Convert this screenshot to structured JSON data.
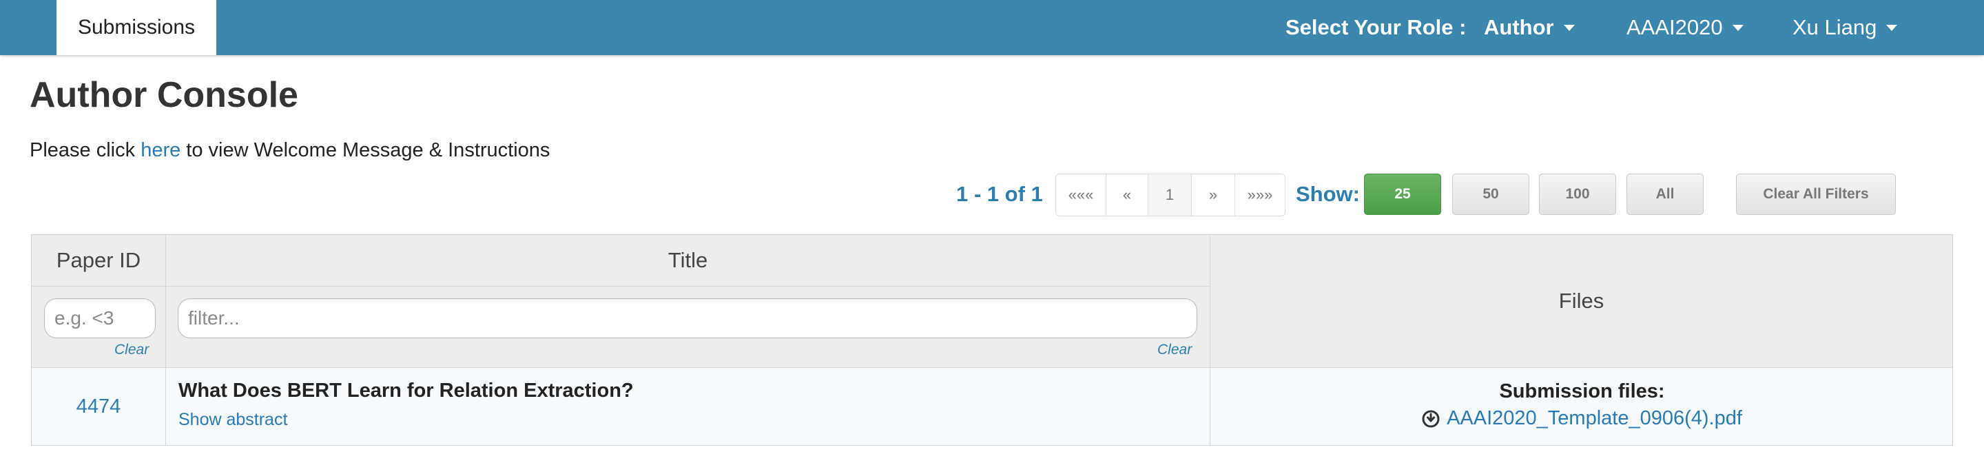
{
  "navbar": {
    "tab_submissions": "Submissions",
    "role_label": "Select Your Role :",
    "role_value": "Author",
    "conference": "AAAI2020",
    "user": "Xu Liang",
    "colors": {
      "bar": "#3b86ad",
      "text": "#ffffff"
    }
  },
  "page": {
    "title": "Author Console",
    "welcome_prefix": "Please click",
    "welcome_link": "here",
    "welcome_suffix": "to view Welcome Message & Instructions"
  },
  "pagination": {
    "range": "1 - 1 of 1",
    "first": "«««",
    "prev": "«",
    "current": "1",
    "next": "»",
    "last": "»»»",
    "show_label": "Show:",
    "sizes": [
      "25",
      "50",
      "100",
      "All"
    ],
    "active_size": "25",
    "clear_filters": "Clear All Filters",
    "colors": {
      "active": "#5cb85c",
      "label": "#2e7eac"
    }
  },
  "table": {
    "headers": {
      "paper_id": "Paper ID",
      "title": "Title",
      "files": "Files"
    },
    "filters": {
      "paper_id_placeholder": "e.g. <3",
      "title_placeholder": "filter...",
      "clear": "Clear"
    },
    "rows": [
      {
        "paper_id": "4474",
        "title": "What Does BERT Learn for Relation Extraction?",
        "show_abstract": "Show abstract",
        "files_label": "Submission files:",
        "file_icon": "download-icon",
        "file_name": "AAAI2020_Template_0906(4).pdf"
      }
    ]
  }
}
